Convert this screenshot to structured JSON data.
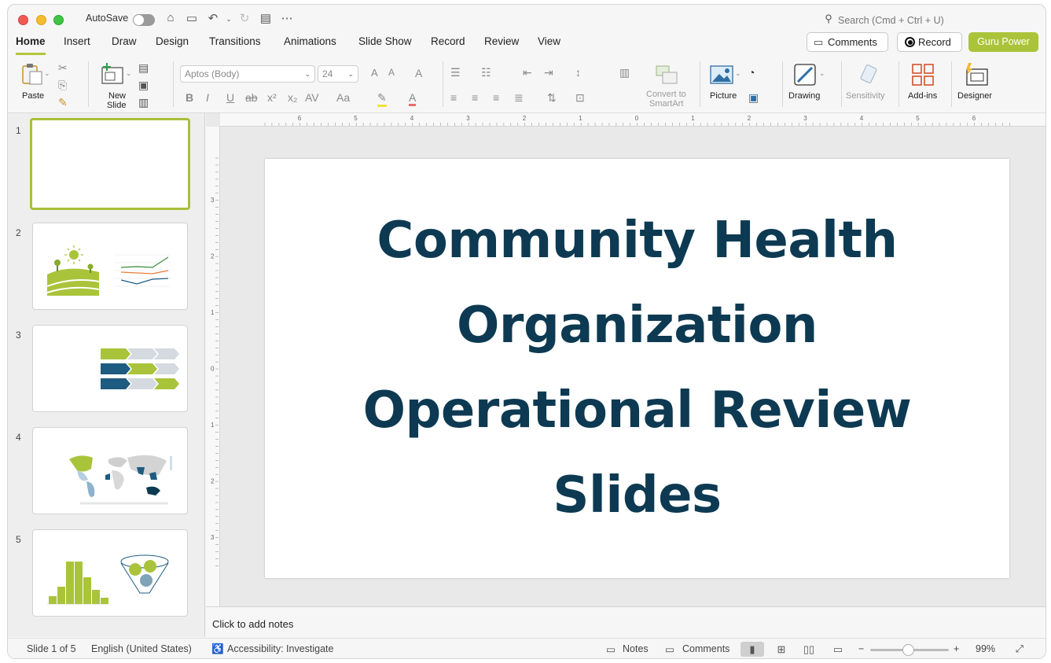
{
  "titlebar": {
    "autosave_label": "AutoSave",
    "search_placeholder": "Search (Cmd + Ctrl + U)"
  },
  "tabs": [
    "Home",
    "Insert",
    "Draw",
    "Design",
    "Transitions",
    "Animations",
    "Slide Show",
    "Record",
    "Review",
    "View"
  ],
  "active_tab": "Home",
  "header_buttons": {
    "comments": "Comments",
    "record": "Record",
    "guru": "Guru Power"
  },
  "ribbon": {
    "paste": "Paste",
    "new_slide_1": "New",
    "new_slide_2": "Slide",
    "font_name": "Aptos (Body)",
    "font_size": "24",
    "convert_1": "Convert to",
    "convert_2": "SmartArt",
    "picture": "Picture",
    "drawing": "Drawing",
    "sensitivity": "Sensitivity",
    "addins": "Add-ins",
    "designer": "Designer"
  },
  "thumbnails": [
    "1",
    "2",
    "3",
    "4",
    "5"
  ],
  "slide": {
    "title_lines": [
      "Community Health",
      "Organization",
      "Operational Review",
      "Slides"
    ]
  },
  "ruler": {
    "h_labels": [
      "6",
      "5",
      "4",
      "3",
      "2",
      "1",
      "0",
      "1",
      "2",
      "3",
      "4",
      "5",
      "6"
    ],
    "v_labels": [
      "3",
      "2",
      "1",
      "0",
      "1",
      "2",
      "3"
    ]
  },
  "notes_placeholder": "Click to add notes",
  "statusbar": {
    "slide_info": "Slide 1 of 5",
    "language": "English (United States)",
    "accessibility": "Accessibility: Investigate",
    "notes": "Notes",
    "comments": "Comments",
    "zoom": "99%"
  },
  "colors": {
    "accent_green": "#a9c43a",
    "title_navy": "#0d3a52",
    "series_teal": "#1e5b80"
  }
}
